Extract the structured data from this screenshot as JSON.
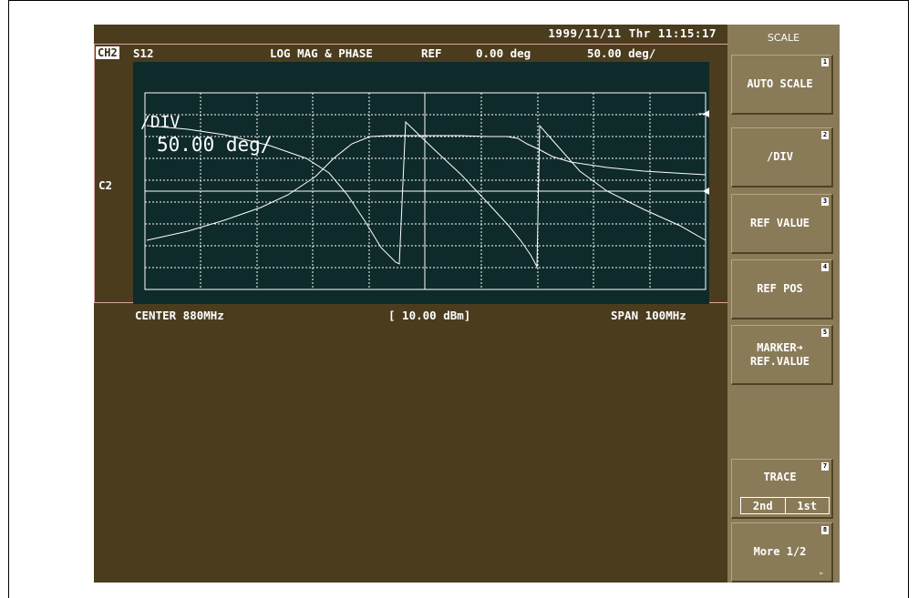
{
  "header": {
    "datetime": "1999/11/11 Thr 11:15:17",
    "channel": "CH2",
    "parameter": "S12",
    "format": "LOG MAG & PHASE",
    "ref_label": "REF",
    "ref_value": "0.00 deg",
    "scale": "50.00 deg/"
  },
  "channel_marker": "C2",
  "overlay": {
    "line1": "/DIV",
    "line2": "50.00 deg/"
  },
  "footer": {
    "center": "CENTER 880MHz",
    "power": "[ 10.00 dBm]",
    "span": "SPAN 100MHz"
  },
  "softkeys": {
    "title": "SCALE",
    "auto_scale": "AUTO SCALE",
    "div": "/DIV",
    "ref_value": "REF VALUE",
    "ref_pos": "REF POS",
    "marker_ref_1": "MARKER➜",
    "marker_ref_2": "REF.VALUE",
    "trace": "TRACE",
    "trace_2nd": "2nd",
    "trace_1st": "1st",
    "more": "More 1/2",
    "nums": [
      "1",
      "2",
      "3",
      "4",
      "5",
      "7",
      "8"
    ]
  },
  "colors": {
    "background": "#4b3c1e",
    "grid_bg": "#0f2a2a",
    "softkey": "#8a7b58",
    "trace": "#ffffff"
  }
}
